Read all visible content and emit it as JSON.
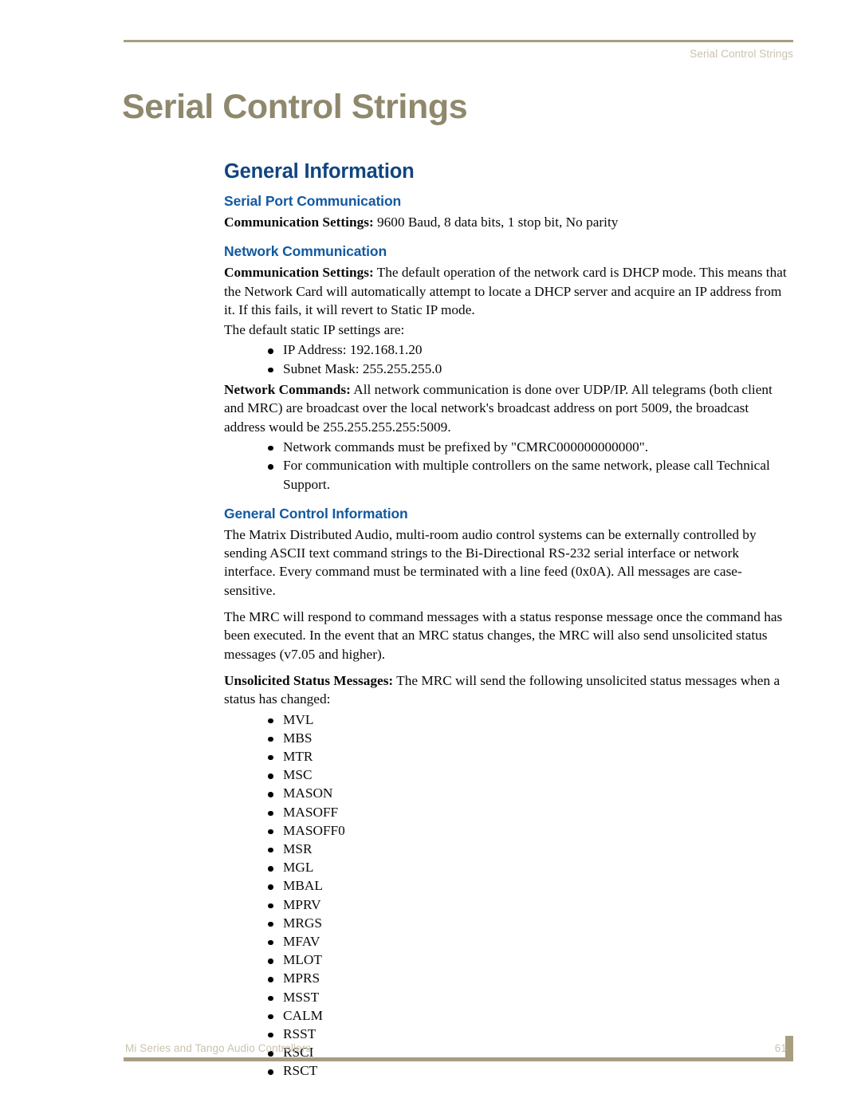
{
  "header": {
    "running_head": "Serial Control Strings"
  },
  "chapter": {
    "title": "Serial Control Strings"
  },
  "sections": {
    "general_information": {
      "heading": "General Information",
      "serial_port": {
        "heading": "Serial Port Communication",
        "paragraph_lead": "Communication Settings:",
        "paragraph_rest": " 9600 Baud, 8 data bits, 1 stop bit, No parity"
      },
      "network": {
        "heading": "Network Communication",
        "settings_lead": "Communication Settings:",
        "settings_rest": " The default operation of the network card is DHCP mode. This means that the Network Card will automatically attempt to locate a DHCP server and acquire an IP address from it. If this fails, it will revert to Static IP mode.",
        "static_intro": "The default static IP settings are:",
        "static_items": [
          "IP Address: 192.168.1.20",
          "Subnet Mask: 255.255.255.0"
        ],
        "commands_lead": "Network Commands:",
        "commands_rest": " All network communication is done over UDP/IP. All telegrams (both client and MRC) are broadcast over the local network's broadcast address on port 5009, the broadcast address would be 255.255.255.255:5009.",
        "commands_items": [
          "Network commands must be prefixed by \"CMRC000000000000\".",
          "For communication with multiple controllers on the same network, please call Technical Support."
        ]
      },
      "general_control": {
        "heading": "General Control Information",
        "paragraph_1": "The Matrix Distributed Audio, multi-room audio control systems can be externally controlled by sending ASCII text command strings to the Bi-Directional RS-232 serial interface or network interface. Every command must be terminated with a line feed (0x0A). All messages are case-sensitive.",
        "paragraph_2": "The MRC will respond to command messages with a status response message once the command has been executed. In the event that an MRC status changes, the MRC will also send unsolicited status messages (v7.05 and higher).",
        "unsolicited_lead": "Unsolicited Status Messages:",
        "unsolicited_rest": " The MRC will send the following unsolicited status messages when a status has changed:",
        "status_codes": [
          "MVL",
          "MBS",
          "MTR",
          "MSC",
          "MASON",
          "MASOFF",
          "MASOFF0",
          "MSR",
          "MGL",
          "MBAL",
          "MPRV",
          "MRGS",
          "MFAV",
          "MLOT",
          "MPRS",
          "MSST",
          "CALM",
          "RSST",
          "RSCI",
          "RSCT"
        ]
      }
    }
  },
  "footer": {
    "document_title": "Mi Series and Tango Audio Controllers",
    "page_number": "61"
  },
  "colors": {
    "title_tan": "#8f886c",
    "rule_tan": "#a79e80",
    "heading_blue": "#10457f",
    "subheading_blue": "#1259a0",
    "header_footer_text": "#c9c3ae",
    "body_text": "#0a0a0a"
  }
}
